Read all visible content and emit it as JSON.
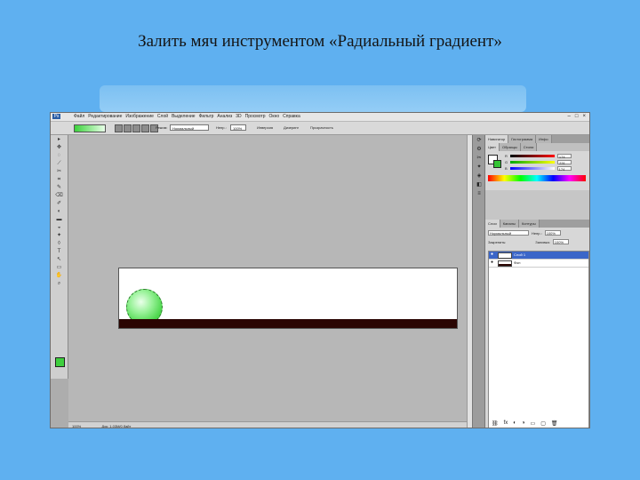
{
  "slide": {
    "title": "Залить мяч инструментом «Радиальный градиент»"
  },
  "app": {
    "logo": "Ps",
    "menus": [
      "Файл",
      "Редактирование",
      "Изображение",
      "Слой",
      "Выделение",
      "Фильтр",
      "Анализ",
      "3D",
      "Просмотр",
      "Окно",
      "Справка"
    ],
    "window_controls": [
      "–",
      "□",
      "×"
    ]
  },
  "options_bar": {
    "mode_label": "Режим:",
    "mode_value": "Нормальный",
    "opacity_label": "Непр.:",
    "opacity_value": "100%",
    "reverse_label": "Инверсия",
    "dither_label": "Дизеринг",
    "transparency_label": "Прозрачность"
  },
  "tools": [
    "▸",
    "✥",
    "◌",
    "⟋",
    "✂",
    "⌗",
    "✎",
    "⌫",
    "✐",
    "◐",
    "▬",
    "◒",
    "✦",
    "◊",
    "T",
    "↖",
    "▭",
    "✋",
    "⌕"
  ],
  "status": {
    "zoom": "100%",
    "doc_info": "Док: 1,03M/0 байт"
  },
  "panel_strip_icons": [
    "⟳",
    "⚙",
    "✂",
    "✦",
    "◈",
    "◧",
    "≡"
  ],
  "color_panel": {
    "tabs": [
      "Навигатор",
      "Гистограмма",
      "Инфо"
    ],
    "sub_tabs": [
      "Цвет",
      "Образцы",
      "Стили"
    ],
    "channels": [
      {
        "label": "R",
        "value": "174",
        "gradient": "linear-gradient(90deg,#000,#f00)"
      },
      {
        "label": "G",
        "value": "231",
        "gradient": "linear-gradient(90deg,#0a0,#ff0)"
      },
      {
        "label": "B",
        "value": "174",
        "gradient": "linear-gradient(90deg,#00f,#fff)"
      }
    ]
  },
  "layers_panel": {
    "tabs": [
      "Слои",
      "Каналы",
      "Контуры"
    ],
    "blend_mode": "Нормальный",
    "opacity_label": "Непр.:",
    "opacity_value": "100%",
    "lock_label": "Закрепить:",
    "fill_label": "Заливка:",
    "fill_value": "100%",
    "layers": [
      {
        "name": "Слой 1",
        "selected": true,
        "thumb": "plain"
      },
      {
        "name": "Фон",
        "selected": false,
        "thumb": "dark"
      }
    ],
    "footer_icons": [
      "⛓",
      "fx",
      "◐",
      "◑",
      "▭",
      "▢",
      "🗑"
    ]
  },
  "colors": {
    "ball_green": "#4fd84f",
    "floor": "#2a0502",
    "selection_blue": "#3b66c8",
    "slide_background": "#5fb0f0"
  }
}
